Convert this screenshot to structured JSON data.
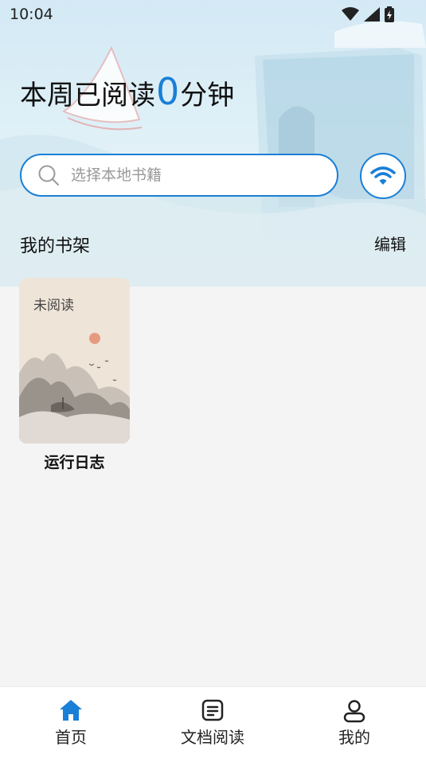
{
  "status_bar": {
    "time": "10:04",
    "icons": [
      "wifi-signal-icon",
      "cell-signal-icon",
      "battery-charging-icon"
    ]
  },
  "header": {
    "headline_prefix": "本周已阅读",
    "minutes": "0",
    "headline_suffix": "分钟"
  },
  "search": {
    "placeholder": "选择本地书籍",
    "icon": "search-icon"
  },
  "wifi_button": {
    "icon": "wifi-icon"
  },
  "shelf": {
    "title": "我的书架",
    "edit_label": "编辑",
    "books": [
      {
        "status": "未阅读",
        "title": "运行日志"
      }
    ]
  },
  "bottom_nav": {
    "items": [
      {
        "label": "首页",
        "icon": "home-icon",
        "active": true
      },
      {
        "label": "文档阅读",
        "icon": "document-icon",
        "active": false
      },
      {
        "label": "我的",
        "icon": "user-icon",
        "active": false
      }
    ]
  },
  "colors": {
    "accent": "#1a7fd6",
    "background": "#f4f4f4",
    "hero_top": "#d3e9f5"
  }
}
